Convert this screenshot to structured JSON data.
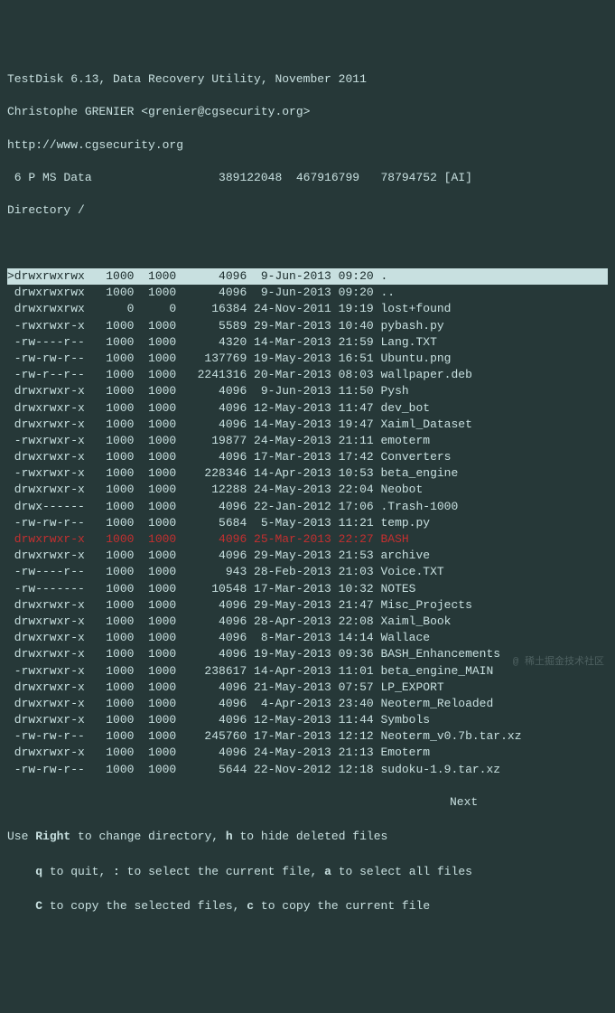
{
  "header": {
    "title": "TestDisk 6.13, Data Recovery Utility, November 2011",
    "author": "Christophe GRENIER <grenier@cgsecurity.org>",
    "url": "http://www.cgsecurity.org",
    "partition": " 6 P MS Data                  389122048  467916799   78794752 [AI]",
    "directory": "Directory /"
  },
  "files": [
    {
      "sel": true,
      "del": false,
      "perm": "drwxrwxrwx",
      "uid": "1000",
      "gid": "1000",
      "size": "4096",
      "date": " 9-Jun-2013",
      "time": "09:20",
      "name": "."
    },
    {
      "sel": false,
      "del": false,
      "perm": "drwxrwxrwx",
      "uid": "1000",
      "gid": "1000",
      "size": "4096",
      "date": " 9-Jun-2013",
      "time": "09:20",
      "name": ".."
    },
    {
      "sel": false,
      "del": false,
      "perm": "drwxrwxrwx",
      "uid": "0",
      "gid": "0",
      "size": "16384",
      "date": "24-Nov-2011",
      "time": "19:19",
      "name": "lost+found"
    },
    {
      "sel": false,
      "del": false,
      "perm": "-rwxrwxr-x",
      "uid": "1000",
      "gid": "1000",
      "size": "5589",
      "date": "29-Mar-2013",
      "time": "10:40",
      "name": "pybash.py"
    },
    {
      "sel": false,
      "del": false,
      "perm": "-rw----r--",
      "uid": "1000",
      "gid": "1000",
      "size": "4320",
      "date": "14-Mar-2013",
      "time": "21:59",
      "name": "Lang.TXT"
    },
    {
      "sel": false,
      "del": false,
      "perm": "-rw-rw-r--",
      "uid": "1000",
      "gid": "1000",
      "size": "137769",
      "date": "19-May-2013",
      "time": "16:51",
      "name": "Ubuntu.png"
    },
    {
      "sel": false,
      "del": false,
      "perm": "-rw-r--r--",
      "uid": "1000",
      "gid": "1000",
      "size": "2241316",
      "date": "20-Mar-2013",
      "time": "08:03",
      "name": "wallpaper.deb"
    },
    {
      "sel": false,
      "del": false,
      "perm": "drwxrwxr-x",
      "uid": "1000",
      "gid": "1000",
      "size": "4096",
      "date": " 9-Jun-2013",
      "time": "11:50",
      "name": "Pysh"
    },
    {
      "sel": false,
      "del": false,
      "perm": "drwxrwxr-x",
      "uid": "1000",
      "gid": "1000",
      "size": "4096",
      "date": "12-May-2013",
      "time": "11:47",
      "name": "dev_bot"
    },
    {
      "sel": false,
      "del": false,
      "perm": "drwxrwxr-x",
      "uid": "1000",
      "gid": "1000",
      "size": "4096",
      "date": "14-May-2013",
      "time": "19:47",
      "name": "Xaiml_Dataset"
    },
    {
      "sel": false,
      "del": false,
      "perm": "-rwxrwxr-x",
      "uid": "1000",
      "gid": "1000",
      "size": "19877",
      "date": "24-May-2013",
      "time": "21:11",
      "name": "emoterm"
    },
    {
      "sel": false,
      "del": false,
      "perm": "drwxrwxr-x",
      "uid": "1000",
      "gid": "1000",
      "size": "4096",
      "date": "17-Mar-2013",
      "time": "17:42",
      "name": "Converters"
    },
    {
      "sel": false,
      "del": false,
      "perm": "-rwxrwxr-x",
      "uid": "1000",
      "gid": "1000",
      "size": "228346",
      "date": "14-Apr-2013",
      "time": "10:53",
      "name": "beta_engine"
    },
    {
      "sel": false,
      "del": false,
      "perm": "drwxrwxr-x",
      "uid": "1000",
      "gid": "1000",
      "size": "12288",
      "date": "24-May-2013",
      "time": "22:04",
      "name": "Neobot"
    },
    {
      "sel": false,
      "del": false,
      "perm": "drwx------",
      "uid": "1000",
      "gid": "1000",
      "size": "4096",
      "date": "22-Jan-2012",
      "time": "17:06",
      "name": ".Trash-1000"
    },
    {
      "sel": false,
      "del": false,
      "perm": "-rw-rw-r--",
      "uid": "1000",
      "gid": "1000",
      "size": "5684",
      "date": " 5-May-2013",
      "time": "11:21",
      "name": "temp.py"
    },
    {
      "sel": false,
      "del": true,
      "perm": "drwxrwxr-x",
      "uid": "1000",
      "gid": "1000",
      "size": "4096",
      "date": "25-Mar-2013",
      "time": "22:27",
      "name": "BASH"
    },
    {
      "sel": false,
      "del": false,
      "perm": "drwxrwxr-x",
      "uid": "1000",
      "gid": "1000",
      "size": "4096",
      "date": "29-May-2013",
      "time": "21:53",
      "name": "archive"
    },
    {
      "sel": false,
      "del": false,
      "perm": "-rw----r--",
      "uid": "1000",
      "gid": "1000",
      "size": "943",
      "date": "28-Feb-2013",
      "time": "21:03",
      "name": "Voice.TXT"
    },
    {
      "sel": false,
      "del": false,
      "perm": "-rw-------",
      "uid": "1000",
      "gid": "1000",
      "size": "10548",
      "date": "17-Mar-2013",
      "time": "10:32",
      "name": "NOTES"
    },
    {
      "sel": false,
      "del": false,
      "perm": "drwxrwxr-x",
      "uid": "1000",
      "gid": "1000",
      "size": "4096",
      "date": "29-May-2013",
      "time": "21:47",
      "name": "Misc_Projects"
    },
    {
      "sel": false,
      "del": false,
      "perm": "drwxrwxr-x",
      "uid": "1000",
      "gid": "1000",
      "size": "4096",
      "date": "28-Apr-2013",
      "time": "22:08",
      "name": "Xaiml_Book"
    },
    {
      "sel": false,
      "del": false,
      "perm": "drwxrwxr-x",
      "uid": "1000",
      "gid": "1000",
      "size": "4096",
      "date": " 8-Mar-2013",
      "time": "14:14",
      "name": "Wallace"
    },
    {
      "sel": false,
      "del": false,
      "perm": "drwxrwxr-x",
      "uid": "1000",
      "gid": "1000",
      "size": "4096",
      "date": "19-May-2013",
      "time": "09:36",
      "name": "BASH_Enhancements"
    },
    {
      "sel": false,
      "del": false,
      "perm": "-rwxrwxr-x",
      "uid": "1000",
      "gid": "1000",
      "size": "238617",
      "date": "14-Apr-2013",
      "time": "11:01",
      "name": "beta_engine_MAIN"
    },
    {
      "sel": false,
      "del": false,
      "perm": "drwxrwxr-x",
      "uid": "1000",
      "gid": "1000",
      "size": "4096",
      "date": "21-May-2013",
      "time": "07:57",
      "name": "LP_EXPORT"
    },
    {
      "sel": false,
      "del": false,
      "perm": "drwxrwxr-x",
      "uid": "1000",
      "gid": "1000",
      "size": "4096",
      "date": " 4-Apr-2013",
      "time": "23:40",
      "name": "Neoterm_Reloaded"
    },
    {
      "sel": false,
      "del": false,
      "perm": "drwxrwxr-x",
      "uid": "1000",
      "gid": "1000",
      "size": "4096",
      "date": "12-May-2013",
      "time": "11:44",
      "name": "Symbols"
    },
    {
      "sel": false,
      "del": false,
      "perm": "-rw-rw-r--",
      "uid": "1000",
      "gid": "1000",
      "size": "245760",
      "date": "17-Mar-2013",
      "time": "12:12",
      "name": "Neoterm_v0.7b.tar.xz"
    },
    {
      "sel": false,
      "del": false,
      "perm": "drwxrwxr-x",
      "uid": "1000",
      "gid": "1000",
      "size": "4096",
      "date": "24-May-2013",
      "time": "21:13",
      "name": "Emoterm"
    },
    {
      "sel": false,
      "del": false,
      "perm": "-rw-rw-r--",
      "uid": "1000",
      "gid": "1000",
      "size": "5644",
      "date": "22-Nov-2012",
      "time": "12:18",
      "name": "sudoku-1.9.tar.xz"
    }
  ],
  "footer": {
    "next": "Next",
    "help1_pre": "Use ",
    "help1_right": "Right",
    "help1_mid": " to change directory, ",
    "help1_h": "h",
    "help1_post": " to hide deleted files",
    "help2_pre": "    ",
    "help2_q": "q",
    "help2_a": " to quit, ",
    "help2_colon": ":",
    "help2_b": " to select the current file, ",
    "help2_akey": "a",
    "help2_c": " to select all files",
    "help3_pre": "    ",
    "help3_C": "C",
    "help3_a": " to copy the selected files, ",
    "help3_ckey": "c",
    "help3_b": " to copy the current file"
  },
  "watermark": "@ 稀土掘金技术社区"
}
